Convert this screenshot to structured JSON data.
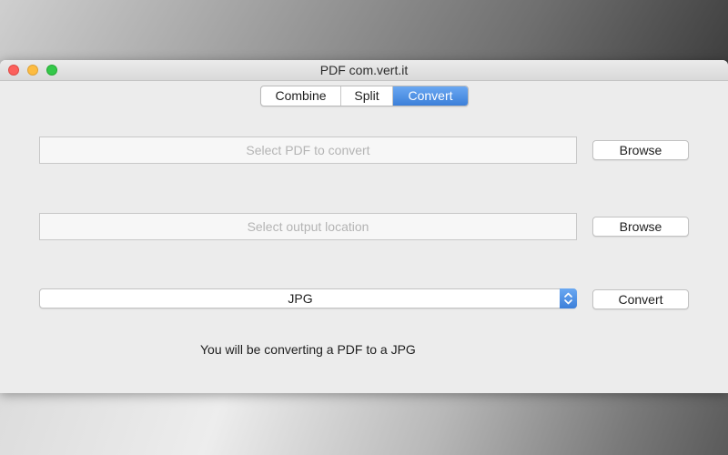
{
  "window": {
    "title": "PDF com.vert.it"
  },
  "tabs": [
    {
      "label": "Combine",
      "selected": false
    },
    {
      "label": "Split",
      "selected": false
    },
    {
      "label": "Convert",
      "selected": true
    }
  ],
  "input_pdf": {
    "value": "",
    "placeholder": "Select PDF to convert",
    "browse_label": "Browse"
  },
  "output_location": {
    "value": "",
    "placeholder": "Select output location",
    "browse_label": "Browse"
  },
  "format": {
    "selected": "JPG",
    "convert_label": "Convert"
  },
  "status_text": "You will be converting a PDF to a JPG",
  "colors": {
    "accent": "#3c7fd9",
    "close": "#fc605c",
    "minimize": "#fdbc40",
    "zoom": "#34c84a"
  },
  "icons": {
    "popup_indicator": "chevron-up-down-icon"
  }
}
